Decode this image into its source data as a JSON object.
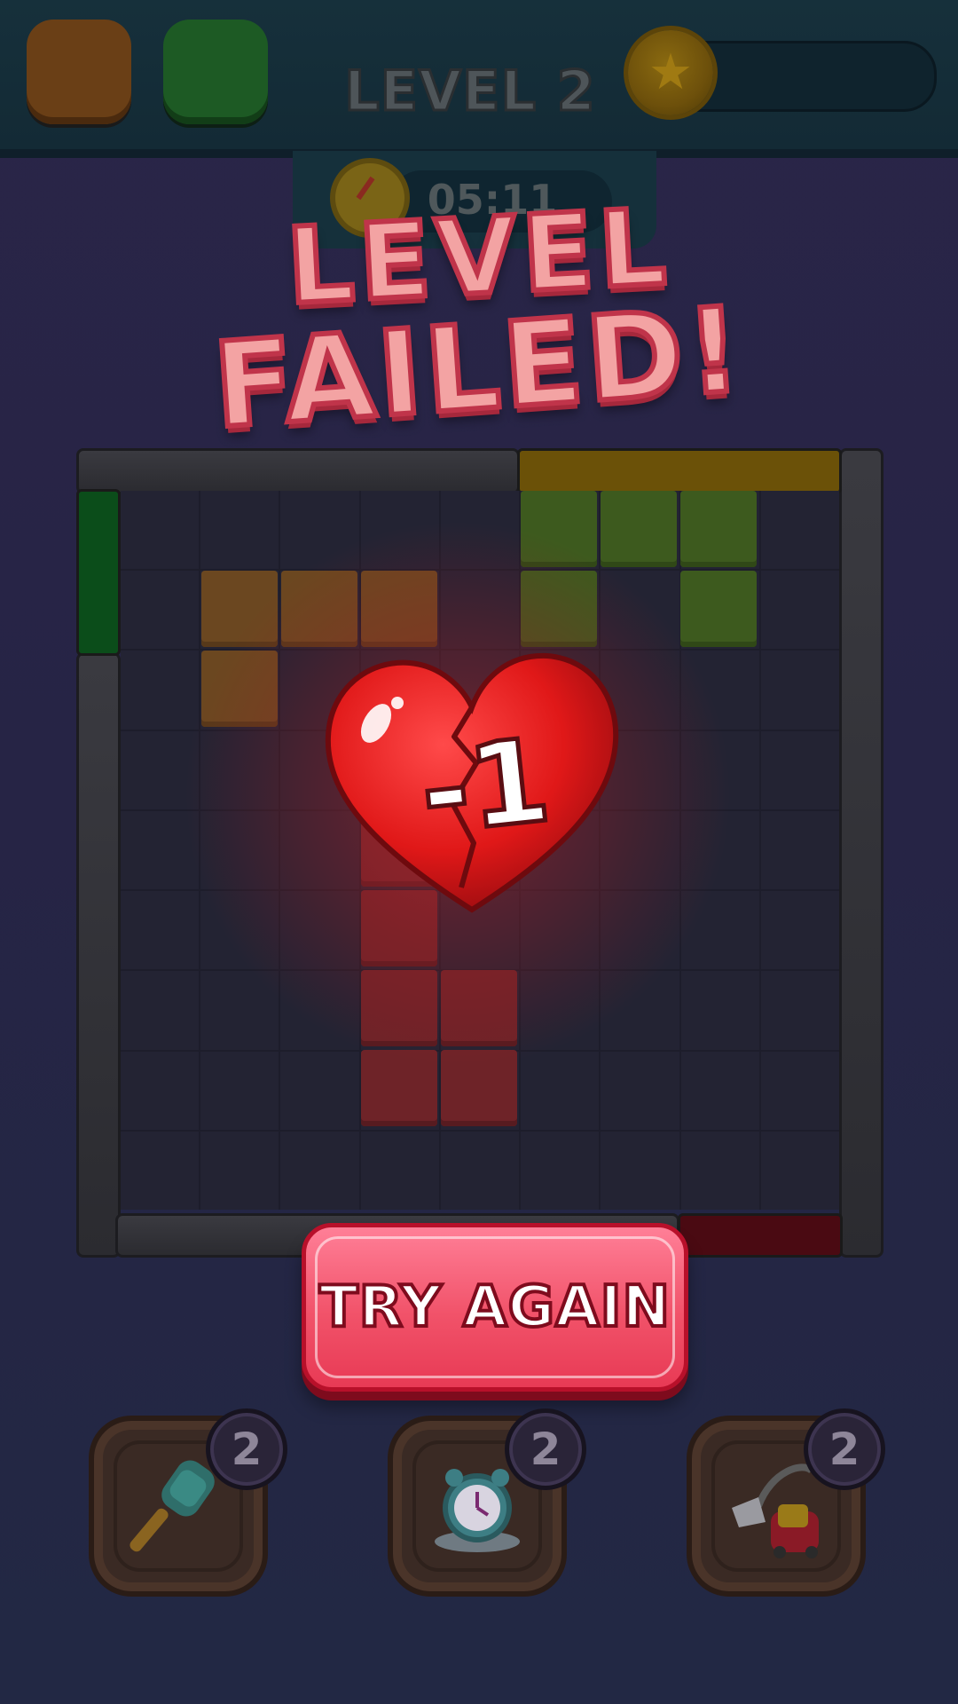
{
  "header": {
    "level_title": "LEVEL 2",
    "timer": "05:11"
  },
  "banner": {
    "line1": "LEVEL",
    "line2": "FAILED!"
  },
  "heart": {
    "label": "-1"
  },
  "try_again": {
    "label": "TRY AGAIN"
  },
  "boosters": [
    {
      "name": "hammer",
      "count": "2",
      "icon": "hammer-icon"
    },
    {
      "name": "clock",
      "count": "2",
      "icon": "alarm-clock-icon"
    },
    {
      "name": "vacuum",
      "count": "2",
      "icon": "vacuum-icon"
    }
  ],
  "colors": {
    "accent_red": "#f15269",
    "banner_pink": "#f3a3a3",
    "gate_yellow": "#6b5108",
    "gate_green": "#0b4d1a",
    "gate_red": "#4a0a12"
  }
}
